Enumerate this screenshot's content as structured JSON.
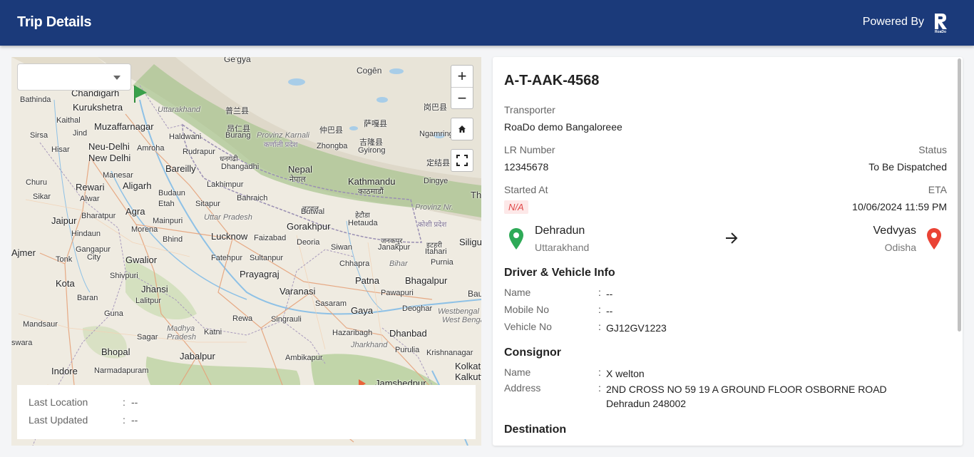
{
  "header": {
    "title": "Trip Details",
    "powered_by": "Powered By",
    "logo_text": "RoaDo",
    "brand_color": "#1b3a7a"
  },
  "map": {
    "selector_value": "",
    "zoom_in": "+",
    "zoom_out": "−",
    "labels": {
      "gegya": "Ge'gya",
      "chandigarh": "Chandigarh",
      "bathinda": "Bathinda",
      "kurukshetra": "Kurukshetra",
      "uttarakhand": "Uttarakhand",
      "kaithal": "Kaithal",
      "muzaffarnagar": "Muzaffarnagar",
      "sirsa": "Sirsa",
      "jind": "Jind",
      "haldwani": "Haldwani",
      "hisar": "Hisar",
      "neudelhi": "Neu-Delhi",
      "newdelhi": "New Delhi",
      "amroha": "Amroha",
      "rudrapur": "Rudrapur",
      "manesar": "Manesar",
      "bareilly": "Bareilly",
      "churu": "Churu",
      "rewari": "Rewari",
      "aligarh": "Aligarh",
      "lakhimpur": "Lakhimpur",
      "sikar": "Sikar",
      "alwar": "Alwar",
      "budaun": "Budaun",
      "bahraich": "Bahraich",
      "agra": "Agra",
      "etah": "Etah",
      "sitapur": "Sitapur",
      "bharatpur": "Bharatpur",
      "jaipur": "Jaipur",
      "mainpuri": "Mainpuri",
      "uttarpradesh": "Uttar Pradesh",
      "hindaun": "Hindaun",
      "morena": "Morena",
      "bhind": "Bhind",
      "lucknow": "Lucknow",
      "faizabad": "Faizabad",
      "gangapur": "Gangapur",
      "city": "City",
      "gwalior": "Gwalior",
      "ajmer": "Ajmer",
      "tonk": "Tonk",
      "fatehpur": "Fatehpur",
      "sultanpur": "Sultanpur",
      "shivpuri": "Shivpuri",
      "prayagraj": "Prayagraj",
      "kota": "Kota",
      "jhansi": "Jhansi",
      "varanasi": "Varanasi",
      "lalitpur": "Lalitpur",
      "baran": "Baran",
      "guna": "Guna",
      "rewa": "Rewa",
      "singrauli": "Singrauli",
      "madhya": "Madhya",
      "pradesh": "Pradesh",
      "mandsaur": "Mandsaur",
      "katni": "Katni",
      "sagar": "Sagar",
      "swara": "swara",
      "bhopal": "Bhopal",
      "jabalpur": "Jabalpur",
      "indore": "Indore",
      "narmadapuram": "Narmadapuram",
      "ambikapur": "Ambikapur",
      "nepal": "Nepal",
      "nepal_dev": "नेपाल",
      "kathmandu": "Kathmandu",
      "kathmandu_dev": "काठमाडौं",
      "provinz_karnali": "Provinz Karnali",
      "karnali_dev": "कर्णाली प्रदेश",
      "dhangadhi": "Dhangadhi",
      "dhangadhi_dev": "धनगढी",
      "burang": "Burang",
      "zhongba": "Zhongba",
      "gyirong": "Gyirong",
      "butwal": "Butwal",
      "butwal_dev": "बुटवल",
      "hetauda": "Hetauda",
      "hetauda_dev": "हेटौडा",
      "gorakhpur": "Gorakhpur",
      "deoria": "Deoria",
      "siwan": "Siwan",
      "janakpur": "Janakpur",
      "janakpur_dev": "जनकपुर",
      "itahari": "Itahari",
      "itahari_dev": "इटहरी",
      "purnia": "Purnia",
      "chhapra": "Chhapra",
      "bihar": "Bihar",
      "patna": "Patna",
      "bhagalpur": "Bhagalpur",
      "pawapuri": "Pawapuri",
      "sasaram": "Sasaram",
      "gaya": "Gaya",
      "deoghar": "Deoghar",
      "westbengal": "Westbengal",
      "west_bengal": "West Bengal",
      "hazaribagh": "Hazaribagh",
      "dhanbad": "Dhanbad",
      "jharkhand": "Jharkhand",
      "purulia": "Purulia",
      "krishnanagar": "Krishnanagar",
      "kolkat": "Kolkat",
      "kalkutt": "Kalkutt",
      "jamshedpur": "Jamshedpur",
      "siligu": "Siligu",
      "th": "Th",
      "bau": "Bau",
      "ngamring": "Ngamring",
      "dingye": "Dingye",
      "provinz_nr": "Provinz Nr.",
      "koshi_dev": "कोशी प्रदेश",
      "cogen": "Cogên",
      "tibet1": "普兰县",
      "tibet2": "仲巴县",
      "tibet3": "萨嘎县",
      "tibet4": "吉隆县",
      "tibet5": "定结县",
      "tibet6": "岗巴县",
      "tibet7": "昂仁县"
    },
    "info": {
      "last_location_label": "Last Location",
      "last_location_value": "--",
      "last_updated_label": "Last Updated",
      "last_updated_value": "--",
      "colon": ":"
    }
  },
  "trip": {
    "id": "A-T-AAK-4568",
    "transporter_label": "Transporter",
    "transporter_value": "RoaDo demo Bangaloreee",
    "lr_label": "LR Number",
    "lr_value": "12345678",
    "status_label": "Status",
    "status_value": "To Be Dispatched",
    "started_label": "Started At",
    "started_value": "N/A",
    "eta_label": "ETA",
    "eta_value": "10/06/2024 11:59 PM",
    "origin": {
      "city": "Dehradun",
      "state": "Uttarakhand",
      "pin_color": "#2eaa57"
    },
    "destination": {
      "city": "Vedvyas",
      "state": "Odisha",
      "pin_color": "#ea4335"
    }
  },
  "driver": {
    "title": "Driver & Vehicle Info",
    "name_label": "Name",
    "name_value": "--",
    "mobile_label": "Mobile No",
    "mobile_value": "--",
    "vehicle_label": "Vehicle No",
    "vehicle_value": "GJ12GV1223"
  },
  "consignor": {
    "title": "Consignor",
    "name_label": "Name",
    "name_value": "X welton",
    "address_label": "Address",
    "address_line1": "2ND CROSS NO 59 19 A GROUND FLOOR OSBORNE ROAD",
    "address_line2": "Dehradun 248002"
  },
  "destination_section": {
    "title": "Destination"
  },
  "colon": ":"
}
